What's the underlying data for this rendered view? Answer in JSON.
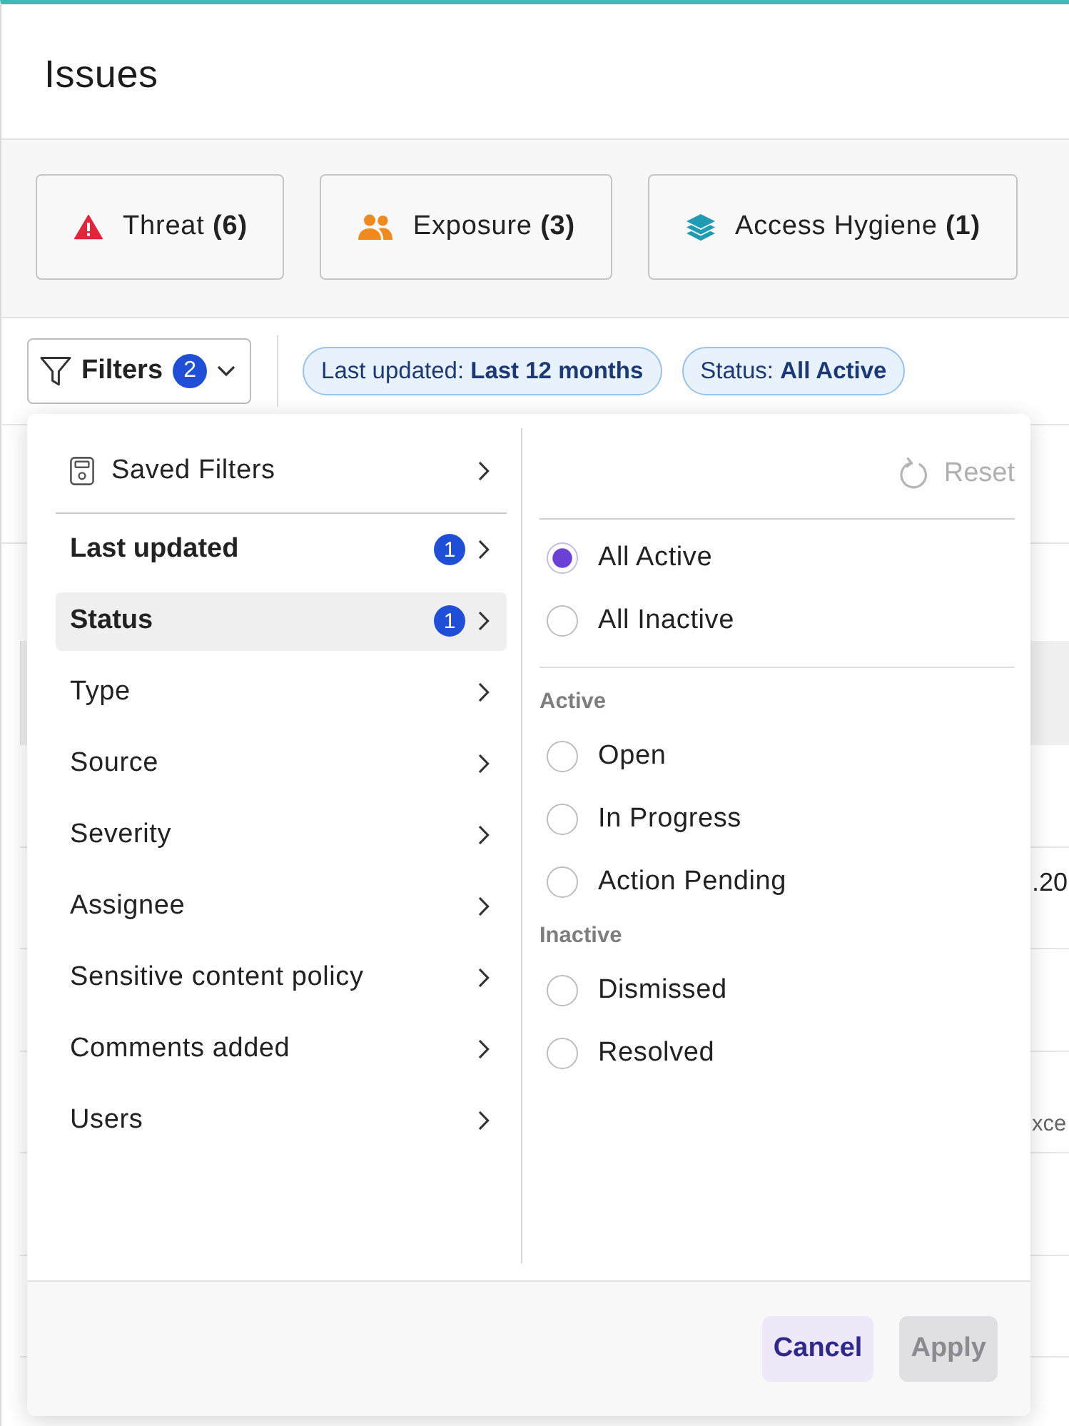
{
  "header": {
    "title": "Issues"
  },
  "categories": [
    {
      "kind": "threat",
      "label": "Threat **(6)**"
    },
    {
      "kind": "exposure",
      "label": "Exposure **(3)**"
    },
    {
      "kind": "access",
      "label": "Access Hygiene **(1)**"
    }
  ],
  "toolbar": {
    "filters_button": {
      "label": "Filters",
      "count": "2"
    },
    "chips": [
      {
        "text": "Last updated: **Last 12 months**"
      },
      {
        "text": "Status: **All Active**"
      }
    ]
  },
  "table": {
    "rows": [
      {
        "kind": "header"
      },
      {
        "kind": "blank"
      },
      {
        "kind": "top",
        "text": ".20"
      },
      {
        "kind": "blank"
      },
      {
        "kind": "bottom",
        "text": "xce"
      },
      {
        "kind": "blank"
      },
      {
        "kind": "blank"
      },
      {
        "kind": "blank"
      }
    ]
  },
  "filter_menu": {
    "saved_filters": {
      "label": "Saved Filters"
    },
    "items": [
      {
        "label": "Last updated",
        "count": "1",
        "selected": false
      },
      {
        "label": "Status",
        "count": "1",
        "selected": true
      },
      {
        "label": "Type",
        "selected": false
      },
      {
        "label": "Source",
        "selected": false
      },
      {
        "label": "Severity",
        "selected": false
      },
      {
        "label": "Assignee",
        "selected": false
      },
      {
        "label": "Sensitive content policy",
        "selected": false
      },
      {
        "label": "Comments added",
        "selected": false
      },
      {
        "label": "Users",
        "selected": false
      }
    ]
  },
  "status_panel": {
    "reset": {
      "label": "Reset",
      "disabled": true
    },
    "options": [
      {
        "label": "All Active",
        "selected": true
      },
      {
        "label": "All Inactive",
        "selected": false
      }
    ],
    "groups": [
      {
        "heading": "Active",
        "options": [
          {
            "label": "Open",
            "selected": false
          },
          {
            "label": "In Progress",
            "selected": false
          },
          {
            "label": "Action Pending",
            "selected": false
          }
        ]
      },
      {
        "heading": "Inactive",
        "options": [
          {
            "label": "Dismissed",
            "selected": false
          },
          {
            "label": "Resolved",
            "selected": false
          }
        ]
      }
    ]
  },
  "footer": {
    "buttons": [
      {
        "kind": "secondary",
        "label": "Cancel",
        "disabled": false
      },
      {
        "kind": "primary",
        "label": "Apply",
        "disabled": true
      }
    ]
  }
}
